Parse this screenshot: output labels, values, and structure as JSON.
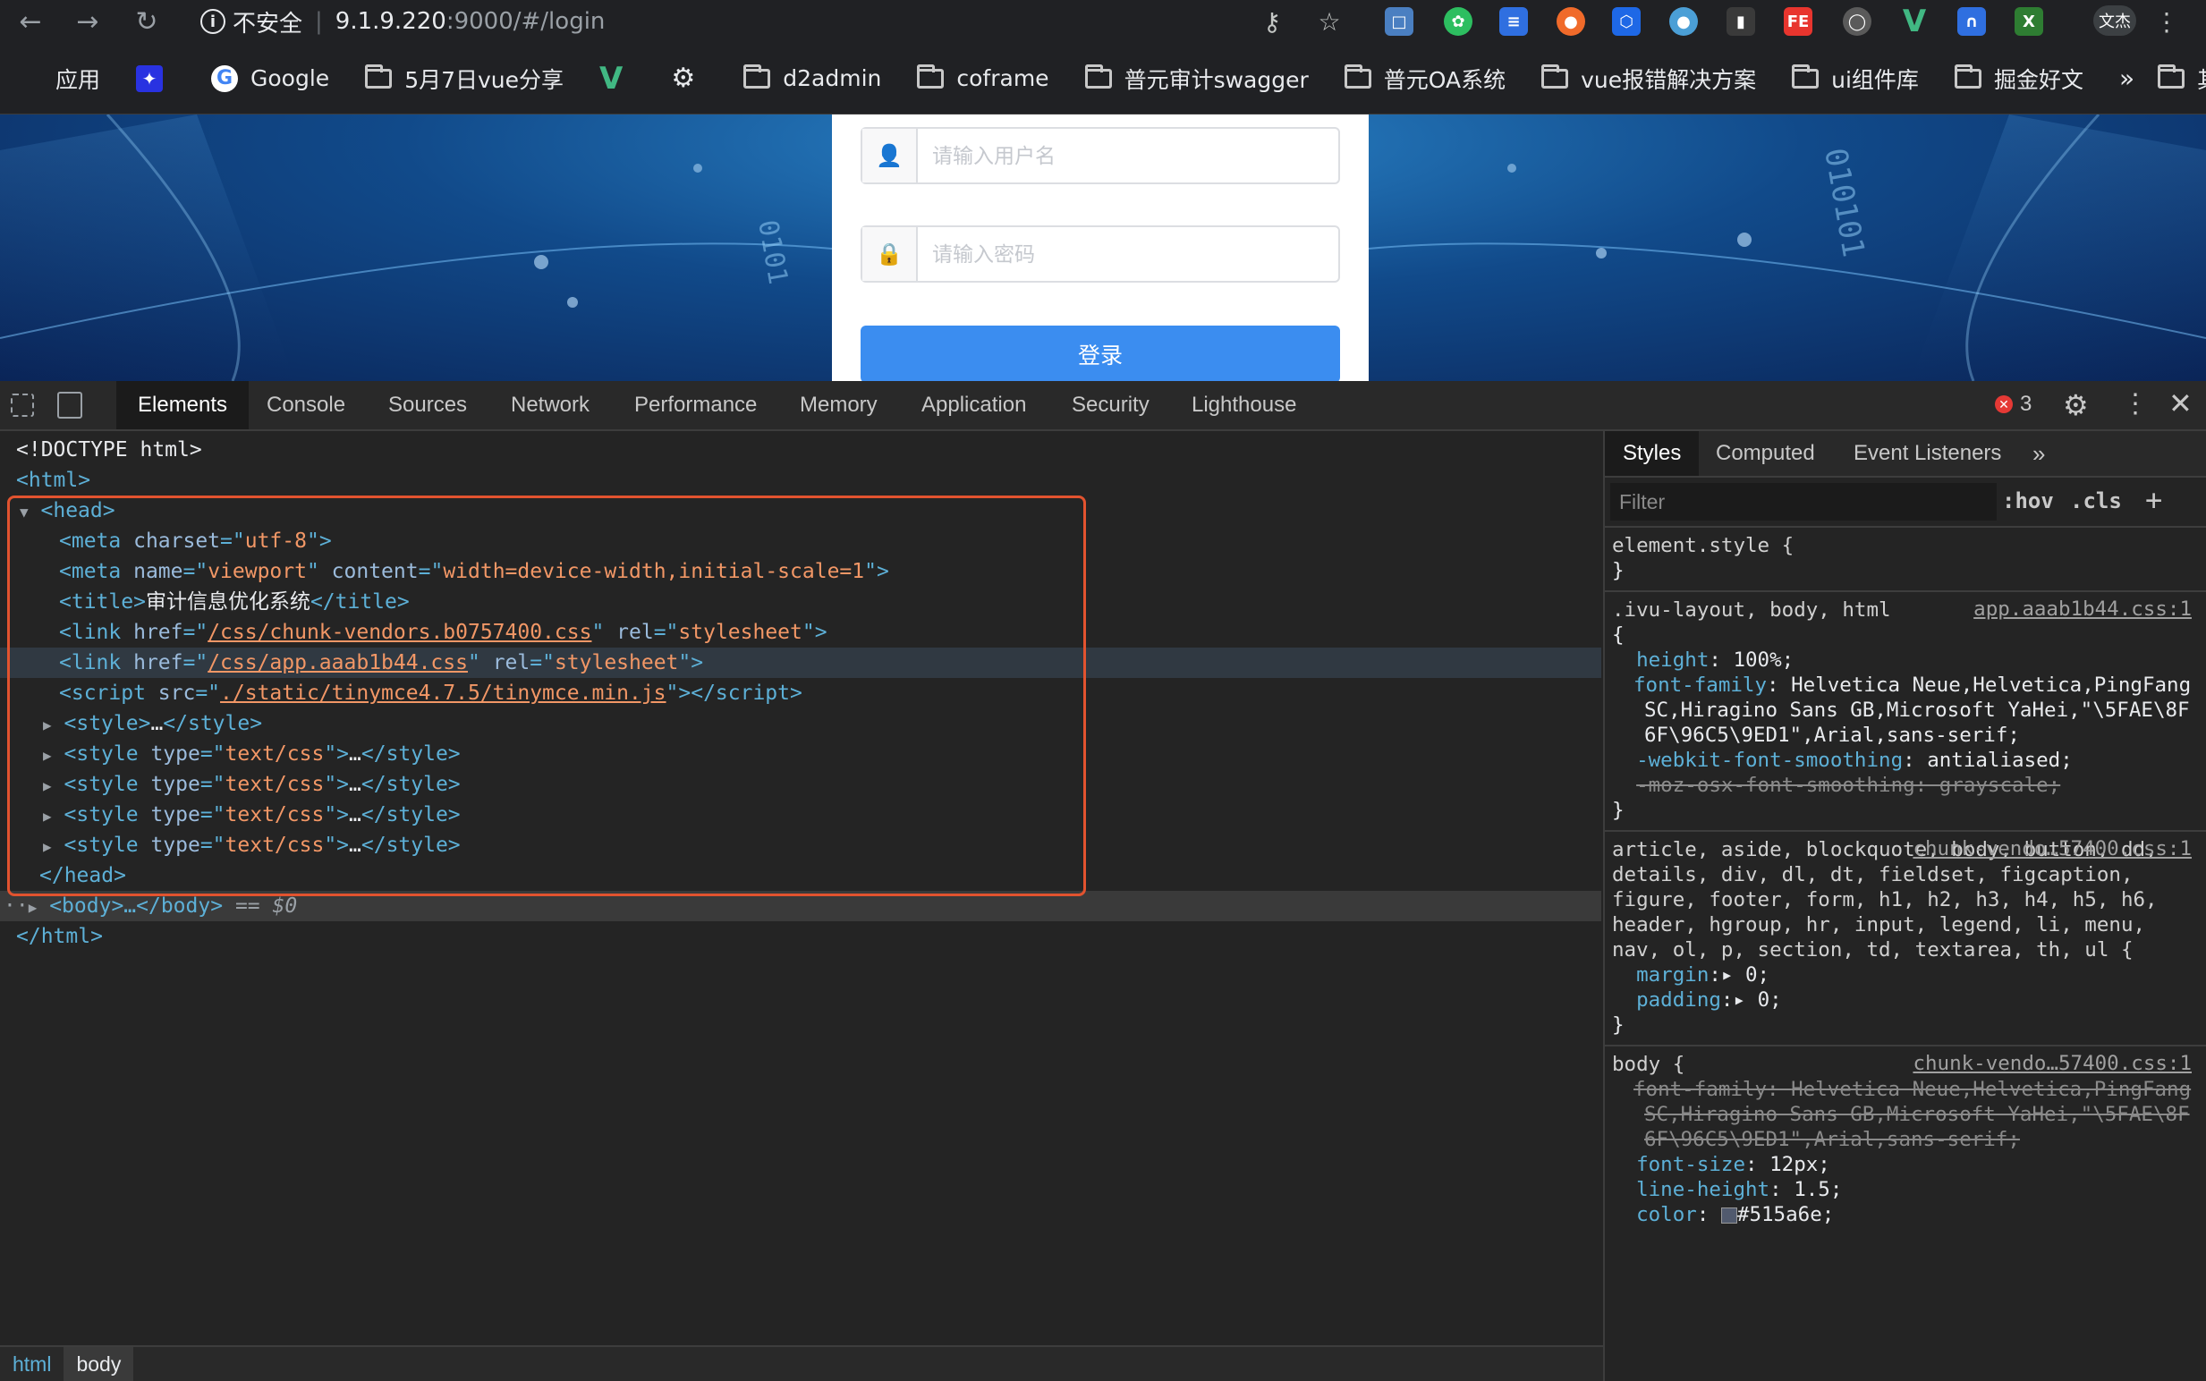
{
  "browser": {
    "security_label": "不安全",
    "url_host": "9.1.9.220",
    "url_path": ":9000/#/login",
    "user_label": "文杰"
  },
  "bookmarks": {
    "apps": "应用",
    "items": [
      "Google",
      "5月7日vue分享",
      "d2admin",
      "coframe",
      "普元审计swagger",
      "普元OA系统",
      "vue报错解决方案",
      "ui组件库",
      "掘金好文"
    ],
    "overflow": "»",
    "other": "其他书签"
  },
  "login": {
    "username_placeholder": "请输入用户名",
    "password_placeholder": "请输入密码",
    "submit_label": "登录"
  },
  "devtools": {
    "tabs": [
      "Elements",
      "Console",
      "Sources",
      "Network",
      "Performance",
      "Memory",
      "Application",
      "Security",
      "Lighthouse"
    ],
    "error_count": "3",
    "dom": {
      "doctype": "<!DOCTYPE html>",
      "html_open": "<html>",
      "head_open": "<head>",
      "meta_charset_val": "utf-8",
      "meta_name_val": "viewport",
      "meta_content_val": "width=device-width,initial-scale=1",
      "title_text": "审计信息优化系统",
      "link1_href": "/css/chunk-vendors.b0757400.css",
      "link2_href": "/css/app.aaab1b44.css",
      "stylesheet": "stylesheet",
      "script_src": "./static/tinymce4.7.5/tinymce.min.js",
      "style_type": "text/css",
      "head_close": "</head>",
      "body_collapsed": "<body>…</body>",
      "selected_marker": "== $0",
      "html_close": "</html>"
    },
    "breadcrumbs": [
      "html",
      "body"
    ]
  },
  "styles_pane": {
    "tabs": [
      "Styles",
      "Computed",
      "Event Listeners"
    ],
    "filter_placeholder": "Filter",
    "hov": ":hov",
    "cls": ".cls",
    "rules": [
      {
        "selector": "element.style {",
        "source": ""
      },
      {
        "selector": ".ivu-layout, body, html",
        "source": "app.aaab1b44.css:1"
      },
      {
        "selector": "article, aside,",
        "source": "chunk-vendo…57400.css:1"
      },
      {
        "selector": "body {",
        "source": "chunk-vendo…57400.css:1"
      }
    ],
    "font_family_value": "Helvetica Neue,Helvetica,PingFang SC,Hiragino Sans GB,Microsoft YaHei,\"\\5FAE\\8F6F\\96C5\\9ED1\",Arial,sans-serif;",
    "reset_selectors": "article, aside, blockquote, body, button, dd, details, div, dl, dt, fieldset, figcaption, figure, footer, form, h1, h2, h3, h4, h5, h6, header, hgroup, hr, input, legend, li, menu, nav, ol, p, section, td, textarea, th, ul {",
    "body_font_size": "12px;",
    "body_line_height": "1.5;",
    "body_color": "#515a6e;",
    "height_value": "100%;",
    "smoothing_value": "antialiased;",
    "moz_smoothing": "-moz-osx-font-smoothing: grayscale;",
    "margin_value": "0;",
    "padding_value": "0;"
  },
  "colors": {
    "accent": "#3b8df0",
    "highlight_border": "#e2532f",
    "devtools_bg": "#242424"
  }
}
